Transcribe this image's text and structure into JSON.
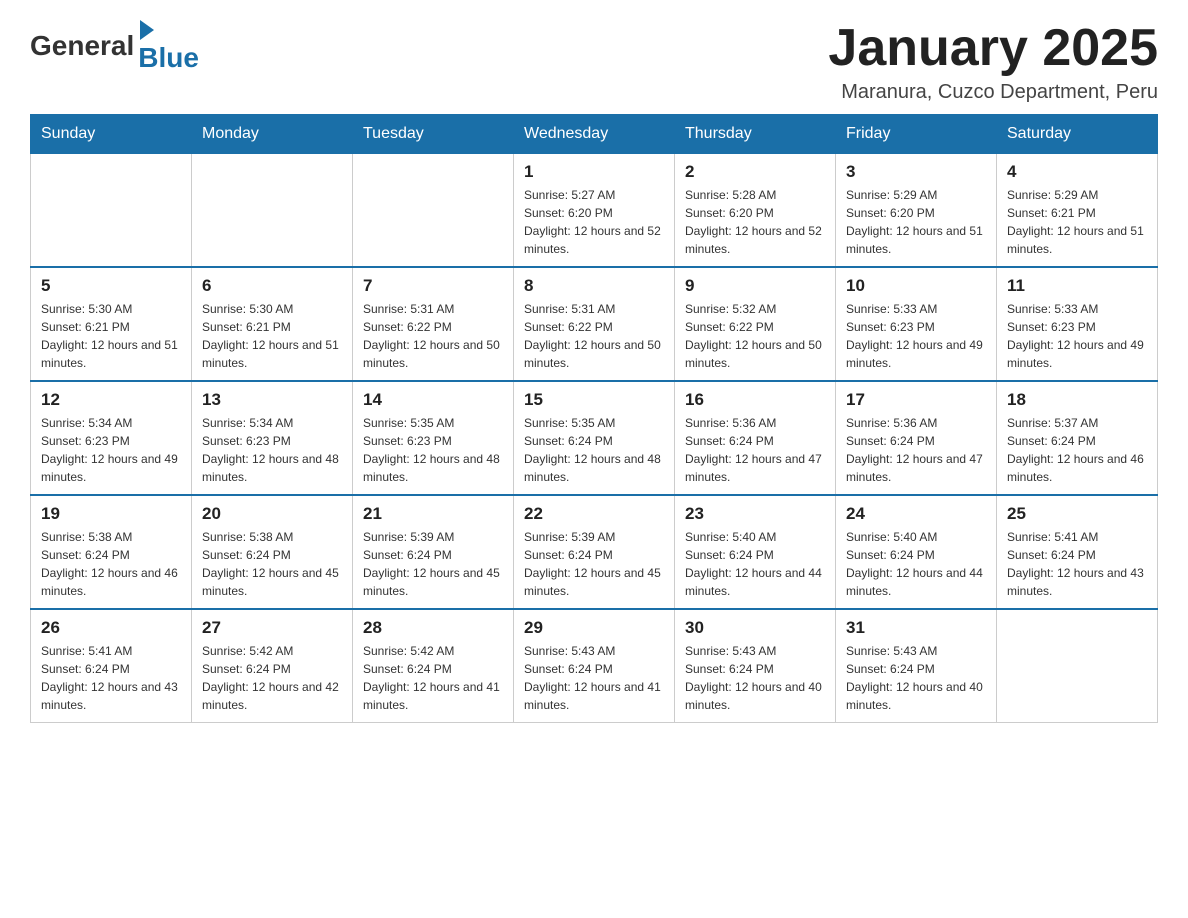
{
  "logo": {
    "text_general": "General",
    "text_blue": "Blue"
  },
  "header": {
    "title": "January 2025",
    "subtitle": "Maranura, Cuzco Department, Peru"
  },
  "days_of_week": [
    "Sunday",
    "Monday",
    "Tuesday",
    "Wednesday",
    "Thursday",
    "Friday",
    "Saturday"
  ],
  "weeks": [
    [
      {
        "day": "",
        "info": ""
      },
      {
        "day": "",
        "info": ""
      },
      {
        "day": "",
        "info": ""
      },
      {
        "day": "1",
        "info": "Sunrise: 5:27 AM\nSunset: 6:20 PM\nDaylight: 12 hours and 52 minutes."
      },
      {
        "day": "2",
        "info": "Sunrise: 5:28 AM\nSunset: 6:20 PM\nDaylight: 12 hours and 52 minutes."
      },
      {
        "day": "3",
        "info": "Sunrise: 5:29 AM\nSunset: 6:20 PM\nDaylight: 12 hours and 51 minutes."
      },
      {
        "day": "4",
        "info": "Sunrise: 5:29 AM\nSunset: 6:21 PM\nDaylight: 12 hours and 51 minutes."
      }
    ],
    [
      {
        "day": "5",
        "info": "Sunrise: 5:30 AM\nSunset: 6:21 PM\nDaylight: 12 hours and 51 minutes."
      },
      {
        "day": "6",
        "info": "Sunrise: 5:30 AM\nSunset: 6:21 PM\nDaylight: 12 hours and 51 minutes."
      },
      {
        "day": "7",
        "info": "Sunrise: 5:31 AM\nSunset: 6:22 PM\nDaylight: 12 hours and 50 minutes."
      },
      {
        "day": "8",
        "info": "Sunrise: 5:31 AM\nSunset: 6:22 PM\nDaylight: 12 hours and 50 minutes."
      },
      {
        "day": "9",
        "info": "Sunrise: 5:32 AM\nSunset: 6:22 PM\nDaylight: 12 hours and 50 minutes."
      },
      {
        "day": "10",
        "info": "Sunrise: 5:33 AM\nSunset: 6:23 PM\nDaylight: 12 hours and 49 minutes."
      },
      {
        "day": "11",
        "info": "Sunrise: 5:33 AM\nSunset: 6:23 PM\nDaylight: 12 hours and 49 minutes."
      }
    ],
    [
      {
        "day": "12",
        "info": "Sunrise: 5:34 AM\nSunset: 6:23 PM\nDaylight: 12 hours and 49 minutes."
      },
      {
        "day": "13",
        "info": "Sunrise: 5:34 AM\nSunset: 6:23 PM\nDaylight: 12 hours and 48 minutes."
      },
      {
        "day": "14",
        "info": "Sunrise: 5:35 AM\nSunset: 6:23 PM\nDaylight: 12 hours and 48 minutes."
      },
      {
        "day": "15",
        "info": "Sunrise: 5:35 AM\nSunset: 6:24 PM\nDaylight: 12 hours and 48 minutes."
      },
      {
        "day": "16",
        "info": "Sunrise: 5:36 AM\nSunset: 6:24 PM\nDaylight: 12 hours and 47 minutes."
      },
      {
        "day": "17",
        "info": "Sunrise: 5:36 AM\nSunset: 6:24 PM\nDaylight: 12 hours and 47 minutes."
      },
      {
        "day": "18",
        "info": "Sunrise: 5:37 AM\nSunset: 6:24 PM\nDaylight: 12 hours and 46 minutes."
      }
    ],
    [
      {
        "day": "19",
        "info": "Sunrise: 5:38 AM\nSunset: 6:24 PM\nDaylight: 12 hours and 46 minutes."
      },
      {
        "day": "20",
        "info": "Sunrise: 5:38 AM\nSunset: 6:24 PM\nDaylight: 12 hours and 45 minutes."
      },
      {
        "day": "21",
        "info": "Sunrise: 5:39 AM\nSunset: 6:24 PM\nDaylight: 12 hours and 45 minutes."
      },
      {
        "day": "22",
        "info": "Sunrise: 5:39 AM\nSunset: 6:24 PM\nDaylight: 12 hours and 45 minutes."
      },
      {
        "day": "23",
        "info": "Sunrise: 5:40 AM\nSunset: 6:24 PM\nDaylight: 12 hours and 44 minutes."
      },
      {
        "day": "24",
        "info": "Sunrise: 5:40 AM\nSunset: 6:24 PM\nDaylight: 12 hours and 44 minutes."
      },
      {
        "day": "25",
        "info": "Sunrise: 5:41 AM\nSunset: 6:24 PM\nDaylight: 12 hours and 43 minutes."
      }
    ],
    [
      {
        "day": "26",
        "info": "Sunrise: 5:41 AM\nSunset: 6:24 PM\nDaylight: 12 hours and 43 minutes."
      },
      {
        "day": "27",
        "info": "Sunrise: 5:42 AM\nSunset: 6:24 PM\nDaylight: 12 hours and 42 minutes."
      },
      {
        "day": "28",
        "info": "Sunrise: 5:42 AM\nSunset: 6:24 PM\nDaylight: 12 hours and 41 minutes."
      },
      {
        "day": "29",
        "info": "Sunrise: 5:43 AM\nSunset: 6:24 PM\nDaylight: 12 hours and 41 minutes."
      },
      {
        "day": "30",
        "info": "Sunrise: 5:43 AM\nSunset: 6:24 PM\nDaylight: 12 hours and 40 minutes."
      },
      {
        "day": "31",
        "info": "Sunrise: 5:43 AM\nSunset: 6:24 PM\nDaylight: 12 hours and 40 minutes."
      },
      {
        "day": "",
        "info": ""
      }
    ]
  ]
}
